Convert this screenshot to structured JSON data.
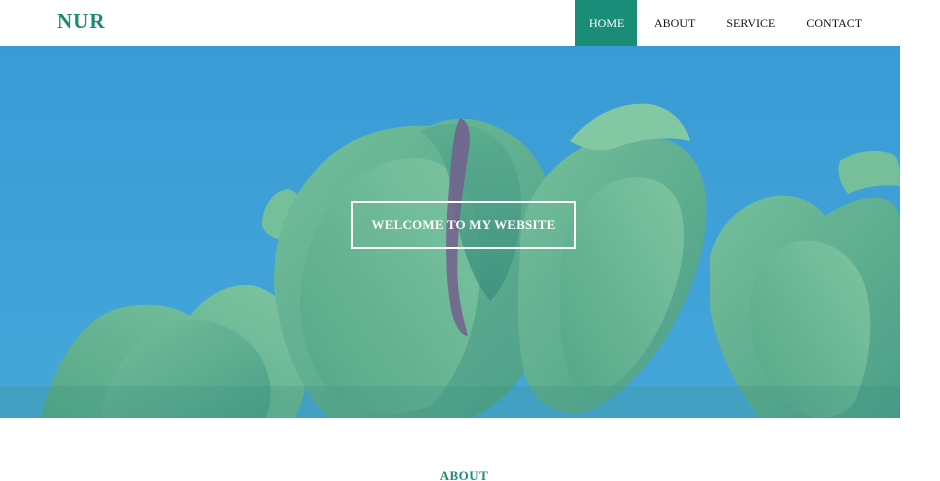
{
  "header": {
    "logo": "NUR",
    "nav": [
      {
        "label": "HOME",
        "active": true
      },
      {
        "label": "ABOUT",
        "active": false
      },
      {
        "label": "SERVICE",
        "active": false
      },
      {
        "label": "CONTACT",
        "active": false
      }
    ]
  },
  "hero": {
    "cta_label": "WELCOME TO MY WEBSITE",
    "background_image": "tulips-photo"
  },
  "about": {
    "title": "ABOUT"
  },
  "colors": {
    "accent": "#1a8c77",
    "sky": "#3fa0dc",
    "tulip": "#5fb48e",
    "white": "#ffffff"
  }
}
